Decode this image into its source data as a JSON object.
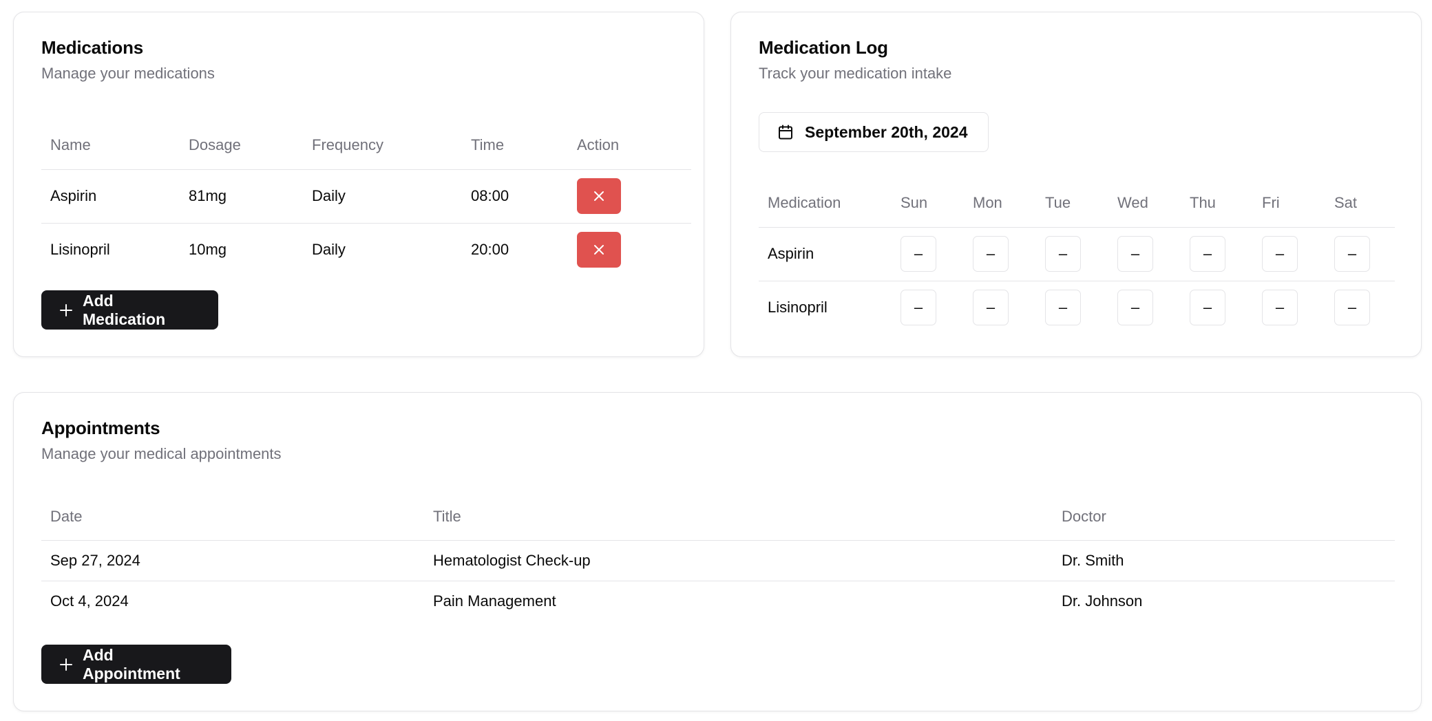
{
  "medications": {
    "title": "Medications",
    "description": "Manage your medications",
    "columns": [
      "Name",
      "Dosage",
      "Frequency",
      "Time",
      "Action"
    ],
    "rows": [
      {
        "name": "Aspirin",
        "dosage": "81mg",
        "frequency": "Daily",
        "time": "08:00"
      },
      {
        "name": "Lisinopril",
        "dosage": "10mg",
        "frequency": "Daily",
        "time": "20:00"
      }
    ],
    "add_label": "Add Medication",
    "delete_color": "#e0524f"
  },
  "log": {
    "title": "Medication Log",
    "description": "Track your medication intake",
    "date": "September 20th, 2024",
    "columns": [
      "Medication",
      "Sun",
      "Mon",
      "Tue",
      "Wed",
      "Thu",
      "Fri",
      "Sat"
    ],
    "rows": [
      {
        "medication": "Aspirin",
        "status": [
          "–",
          "–",
          "–",
          "–",
          "–",
          "–",
          "–"
        ]
      },
      {
        "medication": "Lisinopril",
        "status": [
          "–",
          "–",
          "–",
          "–",
          "–",
          "–",
          "–"
        ]
      }
    ]
  },
  "appointments": {
    "title": "Appointments",
    "description": "Manage your medical appointments",
    "columns": [
      "Date",
      "Title",
      "Doctor"
    ],
    "rows": [
      {
        "date": "Sep 27, 2024",
        "title": "Hematologist Check-up",
        "doctor": "Dr. Smith"
      },
      {
        "date": "Oct 4, 2024",
        "title": "Pain Management",
        "doctor": "Dr. Johnson"
      }
    ],
    "add_label": "Add Appointment"
  },
  "icons": {
    "delete": "x-icon",
    "add": "plus-icon",
    "calendar": "calendar-icon"
  },
  "colors": {
    "primary": "#18181b",
    "destructive": "#e0524f",
    "muted_text": "#71717a",
    "border": "#e4e4e7"
  }
}
